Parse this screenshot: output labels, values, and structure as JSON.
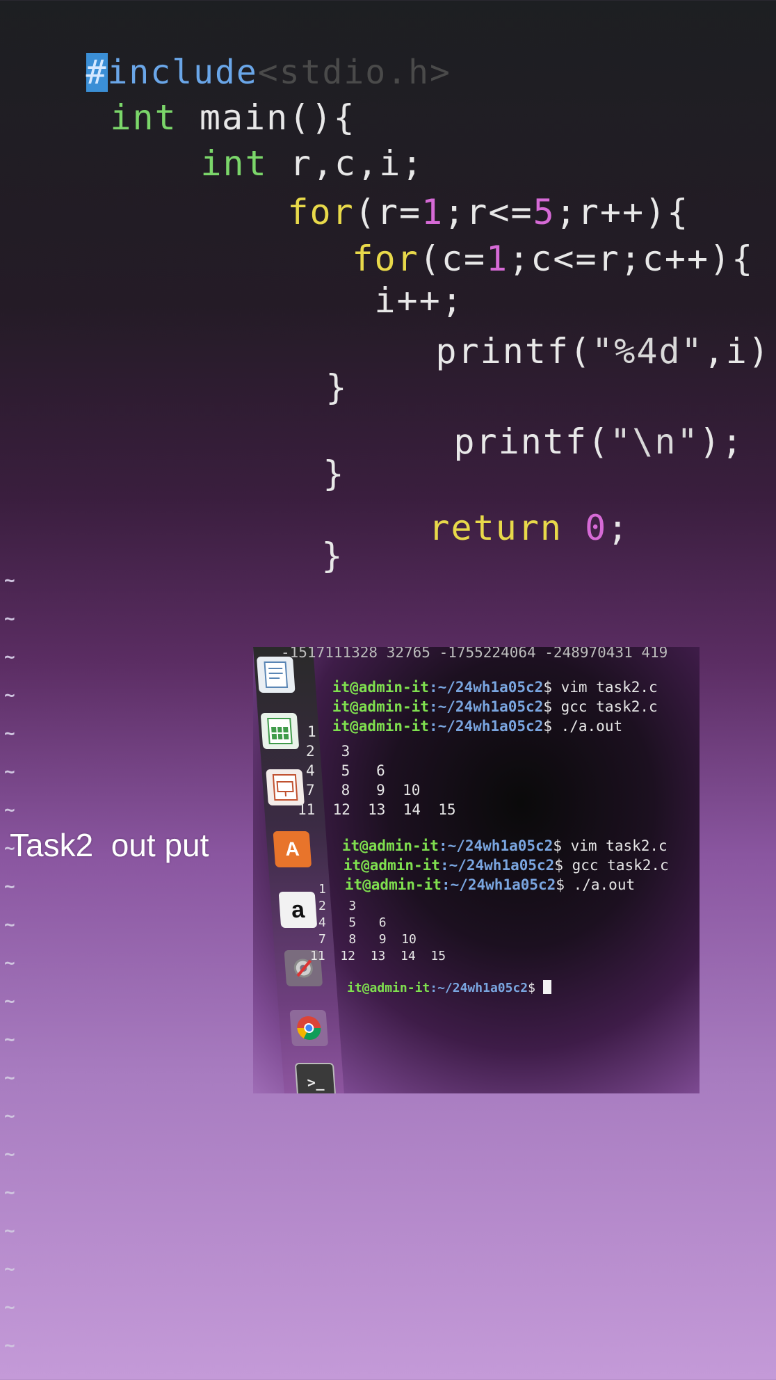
{
  "editor": {
    "cursor_char": "#",
    "include_kw": "include",
    "include_arg": "<stdio.h>",
    "l2_type": "int",
    "l2_rest": " main(){",
    "l3_type": "int",
    "l3_rest": " r,c,i;",
    "l4_kw": "for",
    "l4_a": "(r=",
    "l4_n1": "1",
    "l4_b": ";r<=",
    "l4_n2": "5",
    "l4_c": ";r++){",
    "l5_kw": "for",
    "l5_a": "(c=",
    "l5_n1": "1",
    "l5_b": ";c<=r;c++){",
    "l6": "i++;",
    "l7_a": "printf(",
    "l7_str": "\"%4d\"",
    "l7_b": ",i);",
    "l8": "}",
    "l9_a": "printf(",
    "l9_str": "\"\\n\"",
    "l9_b": ");",
    "l10": "}",
    "l11_kw": "return",
    "l11_n": "0",
    "l11_b": ";",
    "l12": "}",
    "tilde": "~"
  },
  "caption": "Task2  out put",
  "terminal": {
    "top_line": "-1517111328 32765 -1755224064 -248970431 419",
    "prompt_user": "it@admin-it",
    "prompt_path": ":~/24wh1a05c2",
    "prompt_sym": "$ ",
    "cmd_vim": "vim task2.c",
    "cmd_gcc": "gcc task2.c",
    "cmd_run": "./a.out",
    "rows": [
      "1",
      "2   3",
      "4   5   6",
      "7   8   9  10",
      "11  12  13  14  15"
    ]
  },
  "launcher": {
    "icons": [
      "text-editor-icon",
      "spreadsheet-icon",
      "presentation-icon",
      "software-center-icon",
      "amazon-icon",
      "settings-icon",
      "chrome-icon",
      "terminal-icon"
    ],
    "amazon_letter": "a",
    "software_letter": "A",
    "terminal_glyph": ">_"
  }
}
